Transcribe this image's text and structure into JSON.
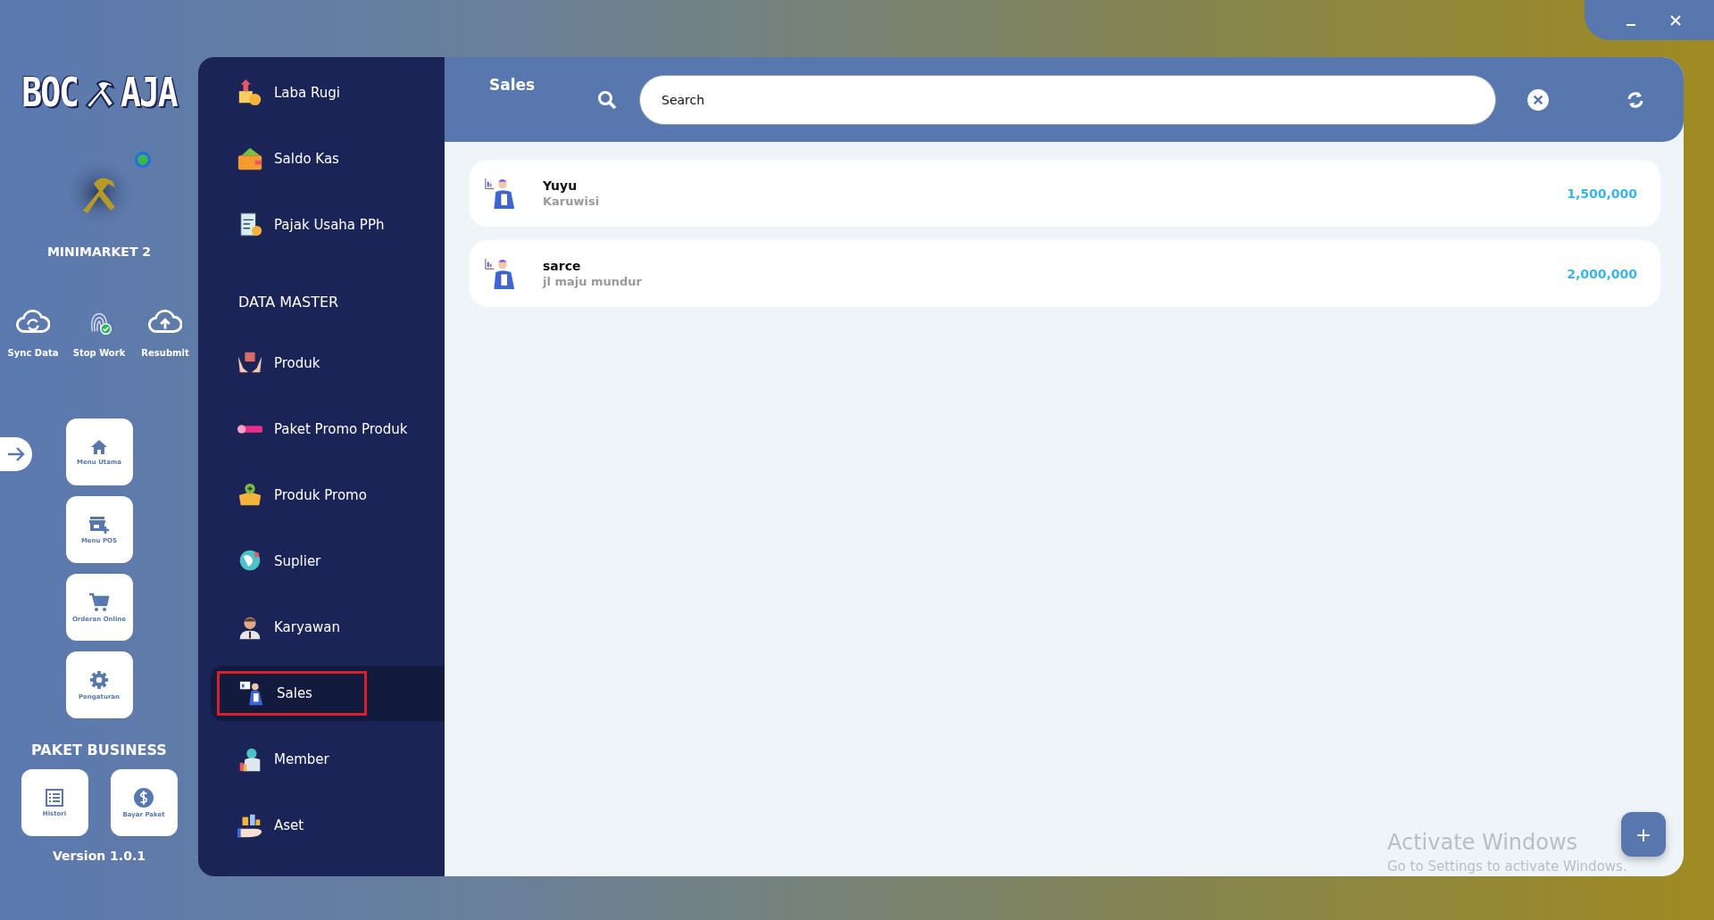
{
  "logo": {
    "left": "BOC",
    "right": "AJA"
  },
  "store": {
    "name": "MINIMARKET 2",
    "online": true
  },
  "actions": [
    {
      "label": "Sync Data"
    },
    {
      "label": "Stop Work"
    },
    {
      "label": "Resubmit"
    }
  ],
  "nav_tiles": [
    {
      "label": "Menu Utama"
    },
    {
      "label": "Menu POS"
    },
    {
      "label": "Orderan Online"
    },
    {
      "label": "Pengaturan"
    }
  ],
  "package": {
    "title": "PAKET BUSINESS",
    "tiles": [
      {
        "label": "Histori"
      },
      {
        "label": "Bayar Paket"
      }
    ]
  },
  "version": "Version 1.0.1",
  "menu": {
    "sections": [
      {
        "items": [
          {
            "label": "Laba Rugi",
            "selected": false
          },
          {
            "label": "Saldo Kas",
            "selected": false
          },
          {
            "label": "Pajak Usaha PPh",
            "selected": false
          }
        ]
      },
      {
        "title": "DATA MASTER",
        "items": [
          {
            "label": "Produk",
            "selected": false
          },
          {
            "label": "Paket Promo Produk",
            "selected": false
          },
          {
            "label": "Produk Promo",
            "selected": false
          },
          {
            "label": "Suplier",
            "selected": false
          },
          {
            "label": "Karyawan",
            "selected": false
          },
          {
            "label": "Sales",
            "selected": true
          },
          {
            "label": "Member",
            "selected": false
          },
          {
            "label": "Aset",
            "selected": false
          }
        ]
      }
    ]
  },
  "header": {
    "title": "Sales",
    "search": {
      "placeholder": "Search"
    }
  },
  "sales": [
    {
      "name": "Yuyu",
      "address": "Karuwisi",
      "amount": "1,500,000"
    },
    {
      "name": "sarce",
      "address": "jl maju mundur",
      "amount": "2,000,000"
    }
  ],
  "add_button": "+",
  "activation_notice": {
    "title": "Activate Windows",
    "text": "Go to Settings to activate Windows."
  }
}
